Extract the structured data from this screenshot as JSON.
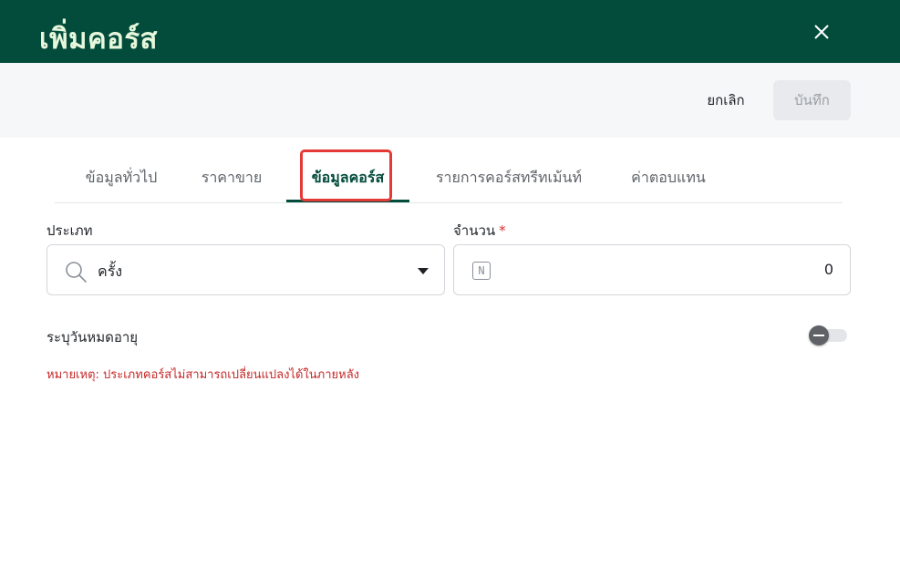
{
  "header": {
    "title": "เพิ่มคอร์ส"
  },
  "actions": {
    "cancel_label": "ยกเลิก",
    "save_label": "บันทึก"
  },
  "tabs": [
    {
      "label": "ข้อมูลทั่วไป",
      "active": false
    },
    {
      "label": "ราคาขาย",
      "active": false
    },
    {
      "label": "ข้อมูลคอร์ส",
      "active": true
    },
    {
      "label": "รายการคอร์สทรีทเม้นท์",
      "active": false
    },
    {
      "label": "ค่าตอบแทน",
      "active": false
    }
  ],
  "form": {
    "type_label": "ประเภท",
    "type_value": "ครั้ง",
    "quantity_label": "จำนวน",
    "quantity_required_mark": "*",
    "quantity_value": "0",
    "quantity_icon_text": "N",
    "expiry_label": "ระบุวันหมดอายุ",
    "expiry_enabled": false,
    "note": "หมายเหตุ: ประเภทคอร์สไม่สามารถเปลี่ยนแปลงได้ในภายหลัง"
  },
  "colors": {
    "header_bg": "#034c3c",
    "accent": "#034c3c",
    "highlight": "#e53935",
    "note": "#c62828"
  }
}
